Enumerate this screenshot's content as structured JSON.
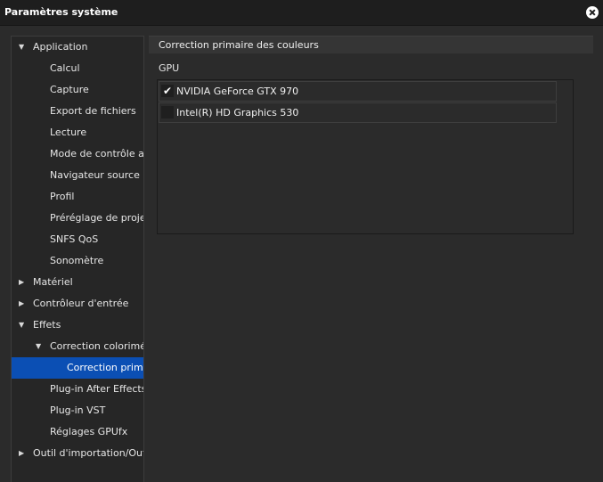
{
  "window": {
    "title": "Paramètres système"
  },
  "sidebar": {
    "items": [
      {
        "label": "Application",
        "level": 0,
        "expander": "down"
      },
      {
        "label": "Calcul",
        "level": 1,
        "expander": ""
      },
      {
        "label": "Capture",
        "level": 1,
        "expander": ""
      },
      {
        "label": "Export de fichiers",
        "level": 1,
        "expander": ""
      },
      {
        "label": "Lecture",
        "level": 1,
        "expander": ""
      },
      {
        "label": "Mode de contrôle audio",
        "level": 1,
        "expander": ""
      },
      {
        "label": "Navigateur source",
        "level": 1,
        "expander": ""
      },
      {
        "label": "Profil",
        "level": 1,
        "expander": ""
      },
      {
        "label": "Préréglage de projets",
        "level": 1,
        "expander": ""
      },
      {
        "label": "SNFS QoS",
        "level": 1,
        "expander": ""
      },
      {
        "label": "Sonomètre",
        "level": 1,
        "expander": ""
      },
      {
        "label": "Matériel",
        "level": 0,
        "expander": "right"
      },
      {
        "label": "Contrôleur d'entrée",
        "level": 0,
        "expander": "right"
      },
      {
        "label": "Effets",
        "level": 0,
        "expander": "down"
      },
      {
        "label": "Correction colorimétrique",
        "level": 1,
        "expander": "down"
      },
      {
        "label": "Correction primaire",
        "level": 2,
        "expander": "",
        "selected": true
      },
      {
        "label": "Plug-in After Effects",
        "level": 1,
        "expander": ""
      },
      {
        "label": "Plug-in VST",
        "level": 1,
        "expander": ""
      },
      {
        "label": "Réglages GPUfx",
        "level": 1,
        "expander": ""
      },
      {
        "label": "Outil d'importation/Outil d'exportation",
        "level": 0,
        "expander": "right"
      }
    ]
  },
  "panel": {
    "header": "Correction primaire des couleurs",
    "gpu_label": "GPU",
    "gpus": [
      {
        "name": "NVIDIA GeForce GTX 970",
        "checked": true
      },
      {
        "name": "Intel(R) HD Graphics 530",
        "checked": false
      }
    ]
  }
}
